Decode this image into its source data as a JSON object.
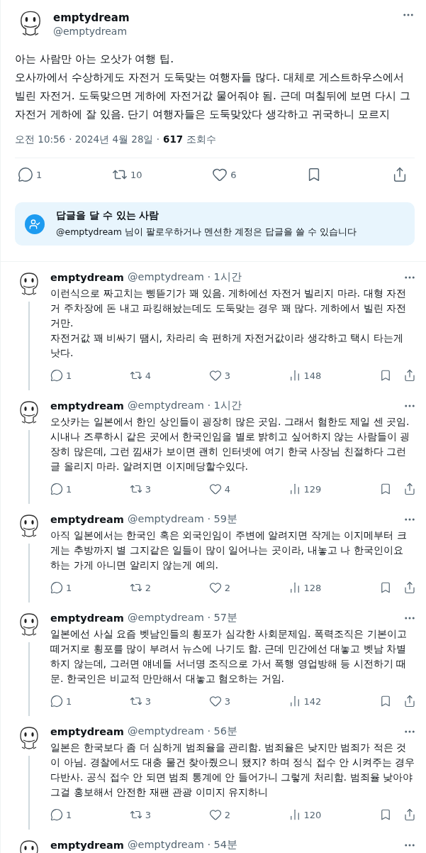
{
  "tweet": {
    "name": "emptydream",
    "handle": "@emptydream",
    "text": "아는 사람만 아는 오삿가 여행 팁.\n오사까에서 수상하게도 자전거 도둑맞는 여행자들 많다. 대체로 게스트하우스에서 빌린 자전거. 도둑맞으면 게하에 자전거값 물어줘야 됨. 근데 며칠뒤에 보면 다시 그 자전거 게하에 잘 있음. 단기 여행자들은 도둑맞았다 생각하고 귀국하니 모르지",
    "time": "오전 10:56",
    "date": "· 2024년 4월 28일 ·",
    "views": "617",
    "views_label": "조회수",
    "replies": "1",
    "retweets": "10",
    "likes": "6"
  },
  "reply_restriction": {
    "title": "답글을 달 수 있는 사람",
    "text": "@emptydream 님이 팔로우하거나 멘션한 계정은 답글을 쓸 수 있습니다"
  },
  "replies": [
    {
      "name": "emptydream",
      "handle": "@emptydream",
      "time": "· 1시간",
      "text": "이런식으로 짜고치는 삥뜯기가 꽤 있음. 게하에선 자전거 빌리지 마라. 대형 자전거 주차장에 돈 내고 파킹해놨는데도 도둑맞는 경우 꽤 많다. 게하에서 빌린 자전거만.\n자전거값 꽤 비싸기 땜시, 차라리 속 편하게 자전거값이라 생각하고 택시 타는게 낫다.",
      "replies": "1",
      "retweets": "4",
      "likes": "3",
      "views": "148"
    },
    {
      "name": "emptydream",
      "handle": "@emptydream",
      "time": "· 1시간",
      "text": "오삿카는 일본에서 한인 상인들이 굉장히 많은 곳임. 그래서 혐한도 제일 센 곳임. 시내나 즈루하시 같은 곳에서 한국인임을 별로 밝히고 싶어하지 않는 사람들이 굉장히 많은데, 그런 낌새가 보이면 괜히 인터넷에 여기 한국 사장님 친절하다 그런 글 올리지 마라. 알려지면 이지메당할수있다.",
      "replies": "1",
      "retweets": "3",
      "likes": "4",
      "views": "129"
    },
    {
      "name": "emptydream",
      "handle": "@emptydream",
      "time": "· 59분",
      "text": "아직 일본에서는 한국인 혹은 외국인임이 주변에 알려지면 작게는 이지메부터 크게는 추방까지 별 그지같은 일들이 많이 일어나는 곳이라, 내놓고 나 한국인이요 하는 가게 아니면 알리지 않는게 예의.",
      "replies": "1",
      "retweets": "2",
      "likes": "2",
      "views": "128"
    },
    {
      "name": "emptydream",
      "handle": "@emptydream",
      "time": "· 57분",
      "text": "일본에선 사실 요즘 벳남인들의 횡포가 심각한 사회문제임. 폭력조직은 기본이고 떼거지로 횡포를 많이 부려서 뉴스에 나기도 함. 근데 민간에선 대놓고 벳남 차별하지 않는데, 그러면 얘네들 서너명 조직으로 가서 폭행 영업방해 등 시전하기 때문. 한국인은 비교적 만만해서 대놓고 혐오하는 거임.",
      "replies": "1",
      "retweets": "3",
      "likes": "3",
      "views": "142"
    },
    {
      "name": "emptydream",
      "handle": "@emptydream",
      "time": "· 56분",
      "text": "일본은 한국보다 좀 더 심하게 범죄율을 관리함. 범죄율은 낮지만 범죄가 적은 것이 아님. 경찰에서도 대충 물건 찾아줬으니 됐지? 하며 정식 접수 안 시켜주는 경우 다반사. 공식 접수 안 되면 범죄 통계에 안 들어가니 그렇게 처리함. 범죄율 낮아야 그걸 홍보해서 안전한 재팬 관광 이미지 유지하니",
      "replies": "1",
      "retweets": "3",
      "likes": "2",
      "views": "120"
    },
    {
      "name": "emptydream",
      "handle": "@emptydream",
      "time": "· 54분"
    }
  ]
}
